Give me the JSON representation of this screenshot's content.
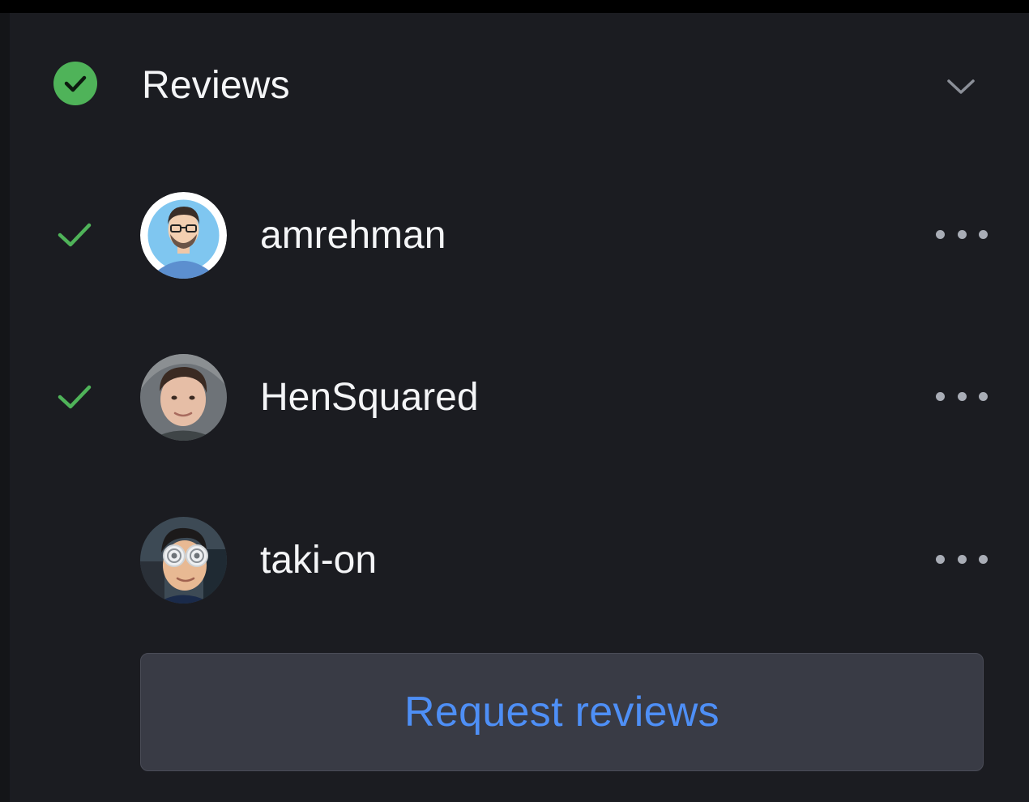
{
  "colors": {
    "panel_bg": "#1b1c21",
    "success_green": "#4fb359",
    "link_blue": "#4e8ff6",
    "muted_icon": "#a9adb6"
  },
  "reviews": {
    "title": "Reviews",
    "status_icon": "check-circle-icon",
    "collapse_icon": "chevron-down-icon",
    "reviewers": [
      {
        "name": "amrehman",
        "approved": true,
        "avatar_icon": "avatar-amrehman"
      },
      {
        "name": "HenSquared",
        "approved": true,
        "avatar_icon": "avatar-hensquared"
      },
      {
        "name": "taki-on",
        "approved": false,
        "avatar_icon": "avatar-taki-on"
      }
    ],
    "request_button_label": "Request reviews"
  }
}
